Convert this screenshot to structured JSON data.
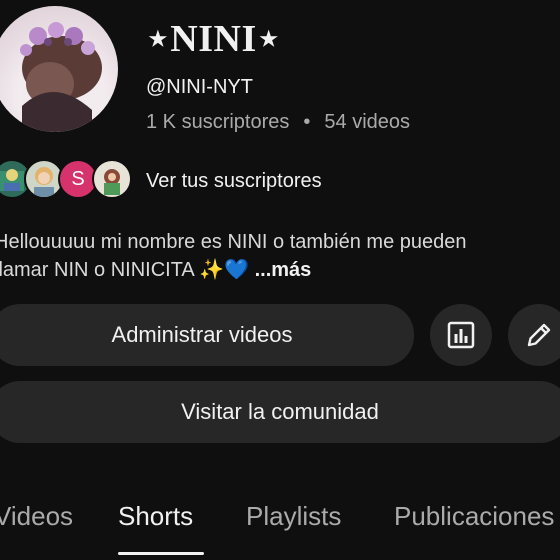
{
  "channel": {
    "name": "⋆NINI⋆",
    "handle": "@NINI-NYT",
    "subscribers": "1 K suscriptores",
    "separator": "•",
    "videos": "54 videos"
  },
  "subscribers_preview": {
    "avatar3_letter": "S",
    "link_label": "Ver tus suscriptores"
  },
  "description": {
    "line1": "Hellouuuuu mi nombre es NINI o también me pueden",
    "line2": "llamar NIN o NINICITA ✨💙 ",
    "more_label": "...más"
  },
  "buttons": {
    "manage_videos": "Administrar videos",
    "analytics_icon": "analytics-icon",
    "edit_icon": "pencil-icon",
    "visit_community": "Visitar la comunidad"
  },
  "tabs": [
    {
      "label": "Videos"
    },
    {
      "label": "Shorts"
    },
    {
      "label": "Playlists"
    },
    {
      "label": "Publicaciones"
    }
  ],
  "active_tab": "Shorts",
  "colors": {
    "background": "#0f0f0f",
    "button": "#272727",
    "text": "#f1f1f1",
    "muted": "#aaaaaa"
  }
}
